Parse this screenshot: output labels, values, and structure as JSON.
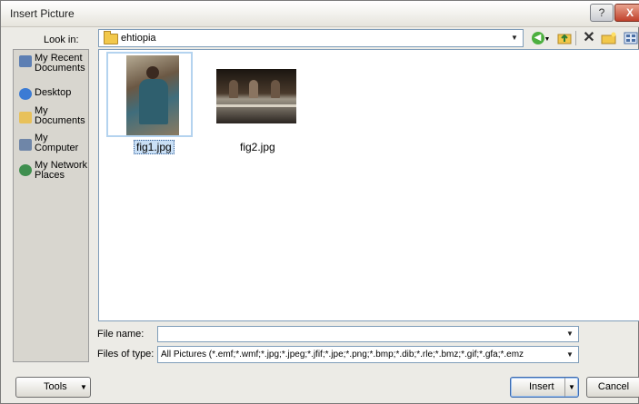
{
  "window": {
    "title": "Insert Picture",
    "help_icon": "?",
    "close_icon": "X"
  },
  "lookin": {
    "label": "Look in:",
    "value": "ehtiopia"
  },
  "toolbar": {
    "back_icon": "back-arrow-icon",
    "up_icon": "up-folder-icon",
    "delete_icon": "delete-icon",
    "new_folder_icon": "new-folder-icon",
    "views_icon": "views-icon"
  },
  "places": [
    {
      "label": "My Recent Documents",
      "icon": "recent-documents-icon",
      "color": "#5d7fb3"
    },
    {
      "label": "Desktop",
      "icon": "desktop-icon",
      "color": "#3b7bd4"
    },
    {
      "label": "My Documents",
      "icon": "my-documents-icon",
      "color": "#e8c15a"
    },
    {
      "label": "My Computer",
      "icon": "computer-icon",
      "color": "#6f86a8"
    },
    {
      "label": "My Network Places",
      "icon": "network-icon",
      "color": "#3f8f4f"
    }
  ],
  "files": [
    {
      "name": "fig1.jpg",
      "selected": true
    },
    {
      "name": "fig2.jpg",
      "selected": false
    }
  ],
  "filename": {
    "label": "File name:",
    "value": ""
  },
  "filetype": {
    "label": "Files of type:",
    "value": "All Pictures (*.emf;*.wmf;*.jpg;*.jpeg;*.jfif;*.jpe;*.png;*.bmp;*.dib;*.rle;*.bmz;*.gif;*.gfa;*.emz"
  },
  "buttons": {
    "tools": "Tools",
    "insert": "Insert",
    "cancel": "Cancel"
  },
  "colors": {
    "dialog_bg": "#ecebe6",
    "selection": "#c9dff5",
    "accent": "#3d6bb0"
  }
}
